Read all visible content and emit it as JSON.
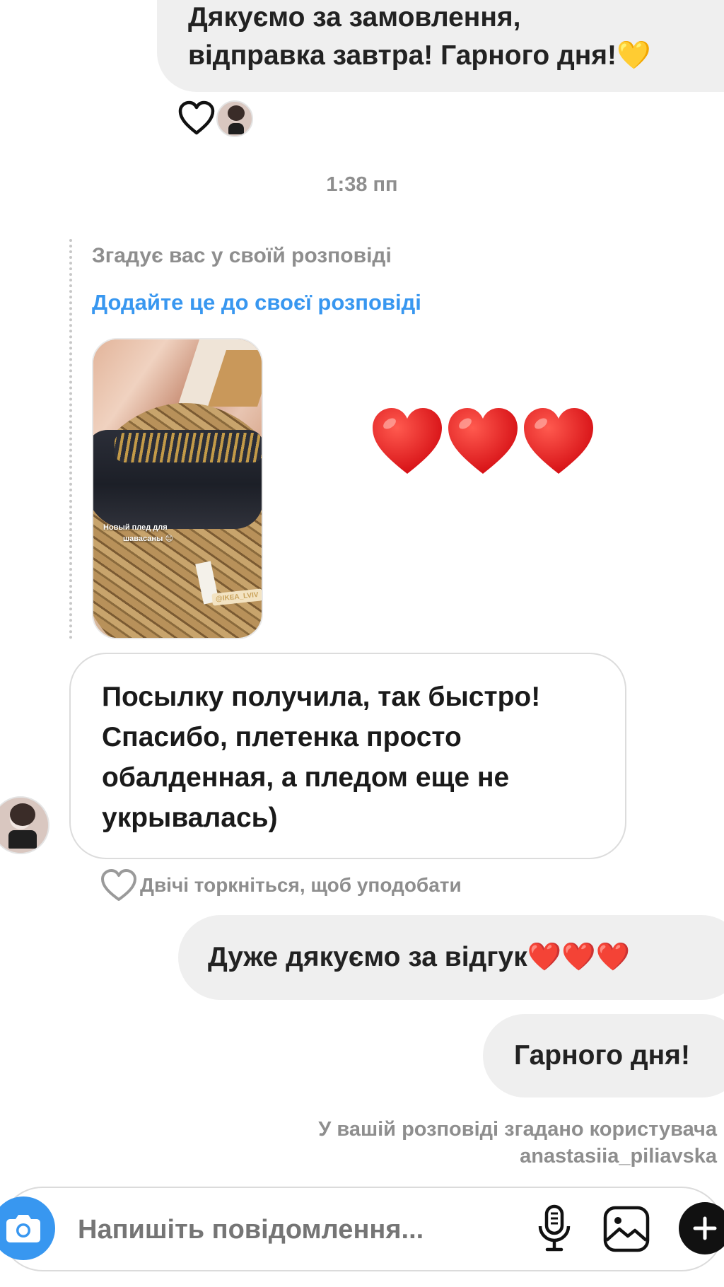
{
  "messages": {
    "first_out_line1": "Дякуємо за замовлення,",
    "first_out_line2": "відправка завтра! Гарного дня!💛",
    "timestamp": "1:38 пп",
    "mention_text": "Згадує вас у своїй розповіді",
    "add_to_story": "Додайте це до своєї розповіді",
    "story_caption_line1": "Новый плед для",
    "story_caption_line2": "шавасаны 😊",
    "story_tag": "@IKEA_LVIV",
    "reaction_emojis": "❤️❤️❤️",
    "incoming_line1": "Посылку получила, так быстро!",
    "incoming_line2": "Спасибо, плетенка просто",
    "incoming_line3": "обалденная, а пледом еще не",
    "incoming_line4": "укрывалась)",
    "double_tap_hint": "Двічі торкніться, щоб уподобати",
    "reply1": "Дуже дякуємо за відгук❤️❤️❤️",
    "reply2": "Гарного дня!",
    "mention_notice_line1": "У вашій розповіді згадано користувача",
    "mention_notice_line2": "anastasiia_piliavska"
  },
  "composer": {
    "placeholder": "Напишіть повідомлення..."
  },
  "icons": {
    "camera": "camera-icon",
    "mic": "microphone-icon",
    "gallery": "gallery-icon",
    "plus": "plus-icon",
    "heart_outline": "heart-outline-icon"
  },
  "colors": {
    "link_blue": "#3897f0",
    "camera_blue": "#3897f0",
    "bubble_gray": "#efefef",
    "meta_gray": "#8e8e8e"
  }
}
